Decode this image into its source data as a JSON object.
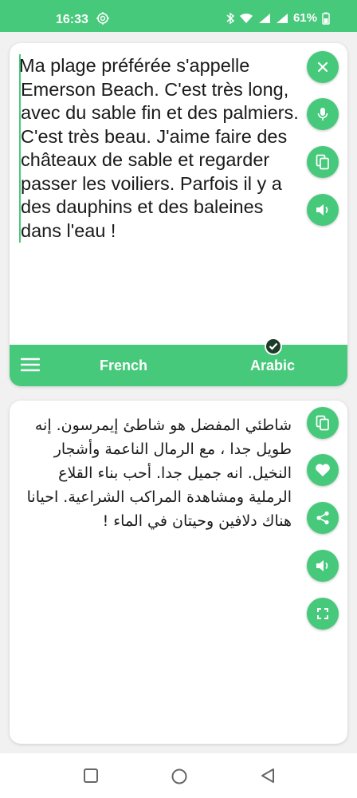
{
  "status": {
    "time": "16:33",
    "battery": "61%"
  },
  "source": {
    "text": "Ma plage préférée s'appelle Emerson Beach. C'est très long, avec du sable fin et des palmiers. C'est très beau. J'aime faire des châteaux de sable et regarder passer les voiliers. Parfois il y a des dauphins et des baleines dans l'eau !"
  },
  "languages": {
    "source": "French",
    "target": "Arabic"
  },
  "target": {
    "text": "شاطئي المفضل هو شاطئ إيمرسون. إنه طويل جدا ، مع الرمال الناعمة وأشجار النخيل. انه جميل جدا. أحب بناء القلاع الرملية ومشاهدة المراكب الشراعية. احيانا هناك دلافين وحيتان في الماء !"
  },
  "icons": {
    "clear": "close-icon",
    "mic": "microphone-icon",
    "copy": "copy-icon",
    "speak": "speaker-icon",
    "favorite": "heart-icon",
    "share": "share-icon",
    "fullscreen": "fullscreen-icon",
    "menu": "menu-icon",
    "selected": "check-icon"
  },
  "colors": {
    "accent": "#46c97a",
    "check": "#1d3b2a"
  }
}
